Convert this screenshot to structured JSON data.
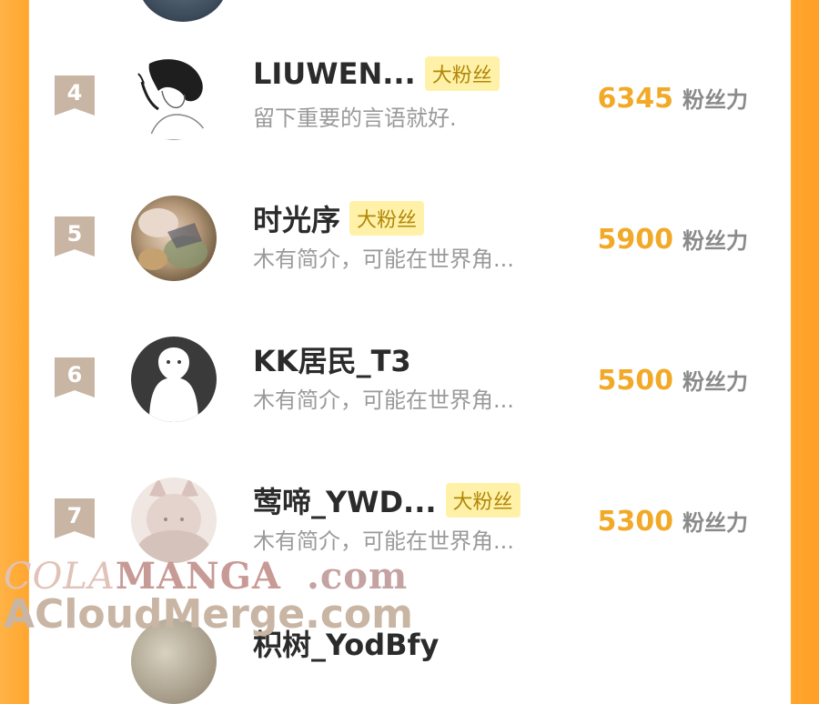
{
  "fans": [
    {
      "rank": "4",
      "name": "LIUWEN...",
      "badge": "大粉丝",
      "bio": "留下重要的言语就好.",
      "score": "6345",
      "unit": "粉丝力",
      "avatar_icon": "sketch-girl-avatar"
    },
    {
      "rank": "5",
      "name": "时光序",
      "badge": "大粉丝",
      "bio": "木有简介，可能在世界角...",
      "score": "5900",
      "unit": "粉丝力",
      "avatar_icon": "illustration-avatar"
    },
    {
      "rank": "6",
      "name": "KK居民_T3",
      "badge": "",
      "bio": "木有简介，可能在世界角...",
      "score": "5500",
      "unit": "粉丝力",
      "avatar_icon": "default-ghost-avatar"
    },
    {
      "rank": "7",
      "name": "莺啼_YWD...",
      "badge": "大粉丝",
      "bio": "木有简介，可能在世界角...",
      "score": "5300",
      "unit": "粉丝力",
      "avatar_icon": "fox-girl-avatar"
    }
  ],
  "partial_next": {
    "name": "枳树_YodBfy"
  },
  "watermark": {
    "cola": "COLA",
    "manga": "MANGA",
    "dotcom": ".com",
    "line2": "ACloudMerge.com"
  },
  "colors": {
    "accent": "#f2a927",
    "side": "#ffa62e",
    "rank_bg": "#c9b5a3",
    "badge_bg": "#fff2a8"
  }
}
